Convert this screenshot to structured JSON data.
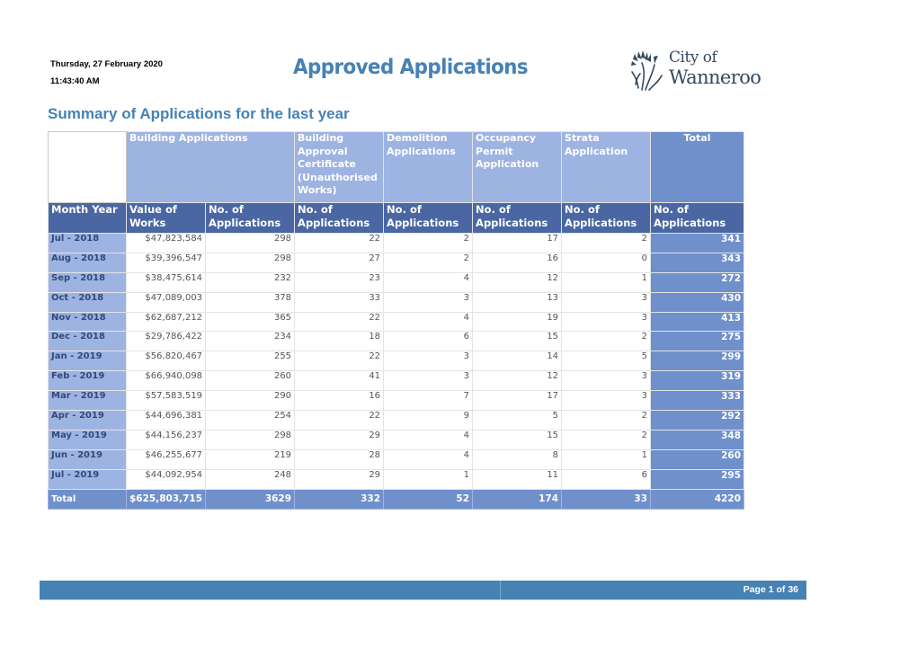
{
  "header": {
    "date": "Thursday, 27 February 2020",
    "time": "11:43:40 AM",
    "title": "Approved Applications",
    "logo": {
      "line1": "City of",
      "line2": "Wanneroo",
      "icon": "kangaroo-paw-icon"
    }
  },
  "section_title": "Summary of Applications for the last year",
  "table": {
    "group_headers": [
      "",
      "Building Applications",
      "Building Approval Certificate (Unauthorised Works)",
      "Demolition Applications",
      "Occupancy Permit Application",
      "Strata Application",
      "Total"
    ],
    "sub_headers": [
      "Month Year",
      "Value of Works",
      "No. of Applications",
      "No. of Applications",
      "No. of Applications",
      "No. of Applications",
      "No. of Applications",
      "No. of Applications"
    ],
    "rows": [
      {
        "month": "Jul - 2018",
        "value": "$47,823,584",
        "building": "298",
        "bac": "22",
        "demolition": "2",
        "occupancy": "17",
        "strata": "2",
        "total": "341"
      },
      {
        "month": "Aug - 2018",
        "value": "$39,396,547",
        "building": "298",
        "bac": "27",
        "demolition": "2",
        "occupancy": "16",
        "strata": "0",
        "total": "343"
      },
      {
        "month": "Sep - 2018",
        "value": "$38,475,614",
        "building": "232",
        "bac": "23",
        "demolition": "4",
        "occupancy": "12",
        "strata": "1",
        "total": "272"
      },
      {
        "month": "Oct - 2018",
        "value": "$47,089,003",
        "building": "378",
        "bac": "33",
        "demolition": "3",
        "occupancy": "13",
        "strata": "3",
        "total": "430"
      },
      {
        "month": "Nov - 2018",
        "value": "$62,687,212",
        "building": "365",
        "bac": "22",
        "demolition": "4",
        "occupancy": "19",
        "strata": "3",
        "total": "413"
      },
      {
        "month": "Dec - 2018",
        "value": "$29,786,422",
        "building": "234",
        "bac": "18",
        "demolition": "6",
        "occupancy": "15",
        "strata": "2",
        "total": "275"
      },
      {
        "month": "Jan - 2019",
        "value": "$56,820,467",
        "building": "255",
        "bac": "22",
        "demolition": "3",
        "occupancy": "14",
        "strata": "5",
        "total": "299"
      },
      {
        "month": "Feb - 2019",
        "value": "$66,940,098",
        "building": "260",
        "bac": "41",
        "demolition": "3",
        "occupancy": "12",
        "strata": "3",
        "total": "319"
      },
      {
        "month": "Mar - 2019",
        "value": "$57,583,519",
        "building": "290",
        "bac": "16",
        "demolition": "7",
        "occupancy": "17",
        "strata": "3",
        "total": "333"
      },
      {
        "month": "Apr - 2019",
        "value": "$44,696,381",
        "building": "254",
        "bac": "22",
        "demolition": "9",
        "occupancy": "5",
        "strata": "2",
        "total": "292"
      },
      {
        "month": "May - 2019",
        "value": "$44,156,237",
        "building": "298",
        "bac": "29",
        "demolition": "4",
        "occupancy": "15",
        "strata": "2",
        "total": "348"
      },
      {
        "month": "Jun - 2019",
        "value": "$46,255,677",
        "building": "219",
        "bac": "28",
        "demolition": "4",
        "occupancy": "8",
        "strata": "1",
        "total": "260"
      },
      {
        "month": "Jul - 2019",
        "value": "$44,092,954",
        "building": "248",
        "bac": "29",
        "demolition": "1",
        "occupancy": "11",
        "strata": "6",
        "total": "295"
      }
    ],
    "totals": {
      "label": "Total",
      "value": "$625,803,715",
      "building": "3629",
      "bac": "332",
      "demolition": "52",
      "occupancy": "174",
      "strata": "33",
      "total": "4220"
    }
  },
  "footer": {
    "page": "Page 1 of 36"
  },
  "colors": {
    "title_blue": "#4682b4",
    "group_header": "#9db3e2",
    "sub_header": "#4a67a3",
    "total_column": "#7090cc",
    "footer_bar": "#4682b4"
  }
}
